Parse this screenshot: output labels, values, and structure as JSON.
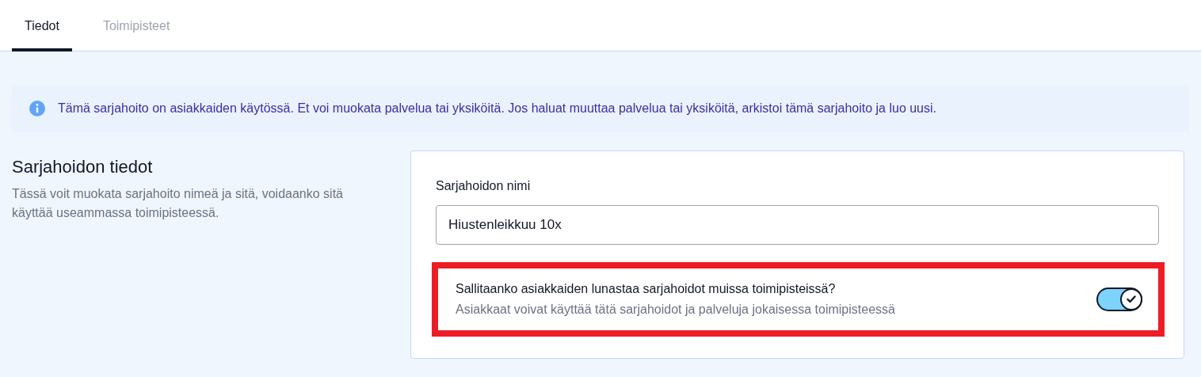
{
  "tabs": [
    {
      "label": "Tiedot",
      "selected": true
    },
    {
      "label": "Toimipisteet",
      "selected": false
    }
  ],
  "notice": {
    "text": "Tämä sarjahoito on asiakkaiden käytössä. Et voi muokata palvelua tai yksiköitä. Jos haluat muuttaa palvelua tai yksiköitä, arkistoi tämä sarjahoito ja luo uusi."
  },
  "section": {
    "title": "Sarjahoidon tiedot",
    "description": "Tässä voit muokata sarjahoito nimeä ja sitä, voidaanko sitä käyttää useammassa toimipisteessä."
  },
  "name_field": {
    "label": "Sarjahoidon nimi",
    "value": "Hiustenleikkuu 10x"
  },
  "setting": {
    "title": "Sallitaanko asiakkaiden lunastaa sarjahoidot muissa toimipisteissä?",
    "description": "Asiakkaat voivat käyttää tätä sarjahoidot ja palveluja jokaisessa toimipisteessä",
    "on": true,
    "highlighted": true
  }
}
